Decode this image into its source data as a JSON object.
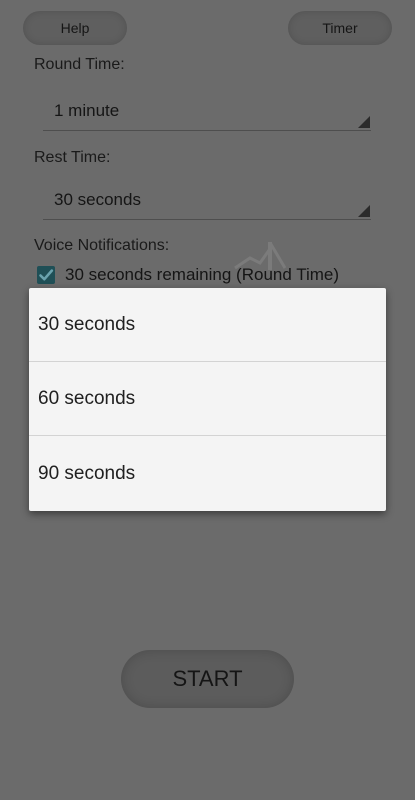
{
  "header": {
    "help_label": "Help",
    "timer_label": "Timer"
  },
  "round_time": {
    "label": "Round Time:",
    "value": "1 minute"
  },
  "rest_time": {
    "label": "Rest Time:",
    "value": "30 seconds"
  },
  "voice": {
    "label": "Voice Notifications:",
    "option_label": "30 seconds remaining (Round Time)",
    "checked": true
  },
  "dropdown": {
    "options": [
      "30 seconds",
      "60 seconds",
      "90 seconds"
    ]
  },
  "start_label": "START",
  "colors": {
    "scrim_background": "#6b6b6b",
    "popup_background": "#f4f4f4",
    "checkbox": "#1f4f56"
  }
}
